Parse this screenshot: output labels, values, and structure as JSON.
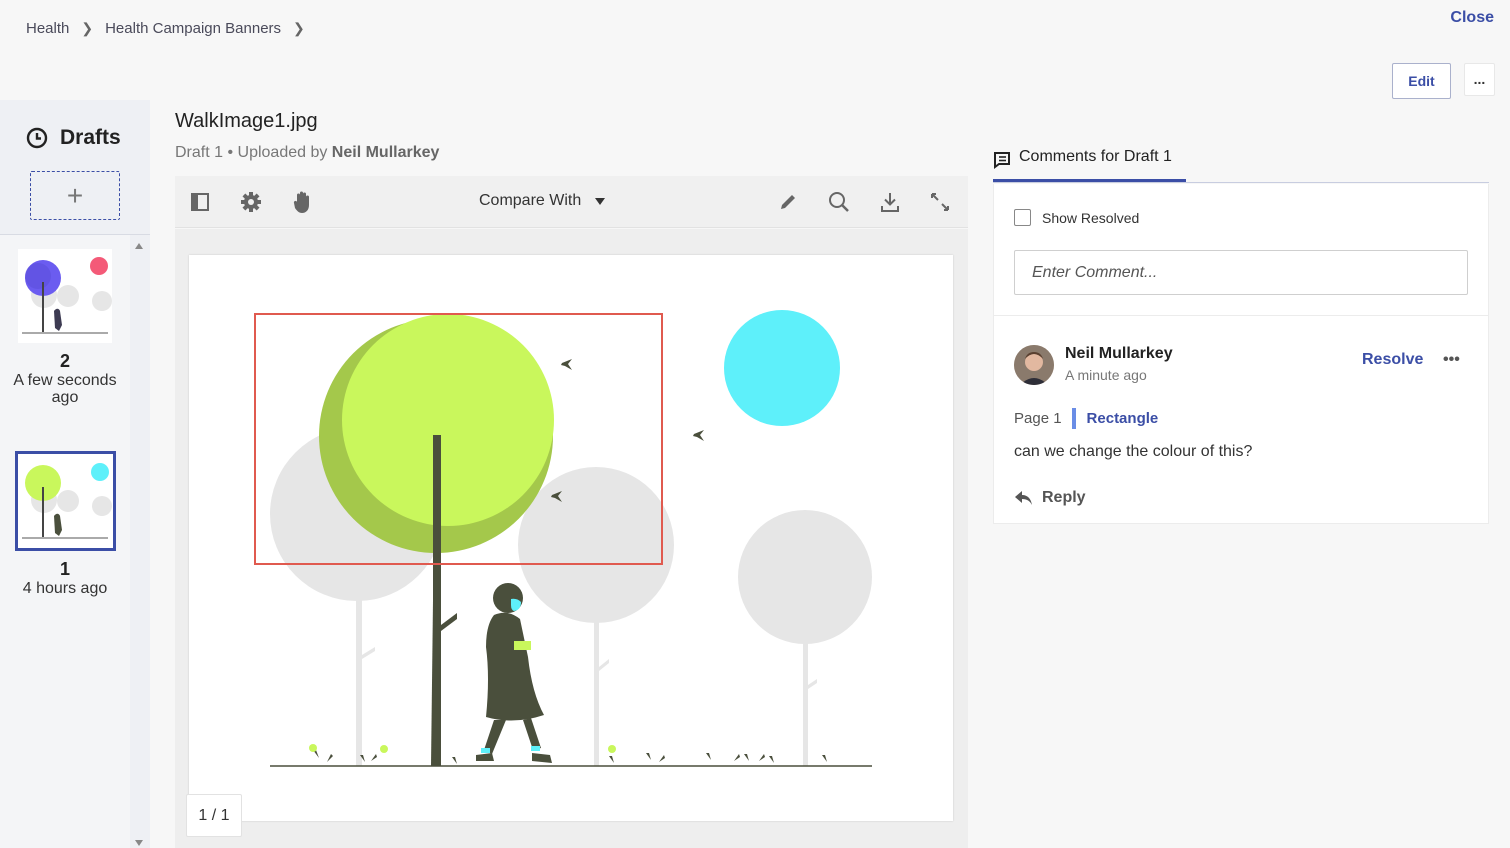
{
  "breadcrumb": {
    "items": [
      "Health",
      "Health Campaign Banners"
    ]
  },
  "header": {
    "close_label": "Close",
    "edit_label": "Edit",
    "more_label": "..."
  },
  "sidebar": {
    "title": "Drafts",
    "add_label": "+",
    "drafts": [
      {
        "number": "2",
        "time": "A few seconds ago",
        "selected": false
      },
      {
        "number": "1",
        "time": "4 hours ago",
        "selected": true
      }
    ]
  },
  "viewer": {
    "file_name": "WalkImage1.jpg",
    "draft_label": "Draft 1",
    "uploaded_prefix": " • Uploaded by ",
    "uploader": "Neil Mullarkey",
    "compare_label": "Compare With",
    "page_count": "1 / 1",
    "tools": [
      "panel-toggle-icon",
      "settings-icon",
      "pan-hand-icon",
      "pencil-icon",
      "search-icon",
      "download-icon",
      "fullscreen-icon"
    ]
  },
  "comments": {
    "tab_label": "Comments for Draft 1",
    "show_resolved_label": "Show Resolved",
    "input_placeholder": "Enter Comment...",
    "items": [
      {
        "author": "Neil Mullarkey",
        "time": "A minute ago",
        "resolve_label": "Resolve",
        "more_label": "•••",
        "page_label": "Page 1",
        "shape_label": "Rectangle",
        "text": "can we change the colour of this?",
        "reply_label": "Reply"
      }
    ]
  },
  "colors": {
    "accent": "#3b4ea6",
    "annotation_red": "#e05a4f",
    "tree_green": "#c9f75c",
    "tree_green_dark": "#a4c84b",
    "cyan_circle": "#5ef0fa",
    "gray_circle": "#e6e6e6",
    "figure_dark": "#4a4f3c"
  }
}
